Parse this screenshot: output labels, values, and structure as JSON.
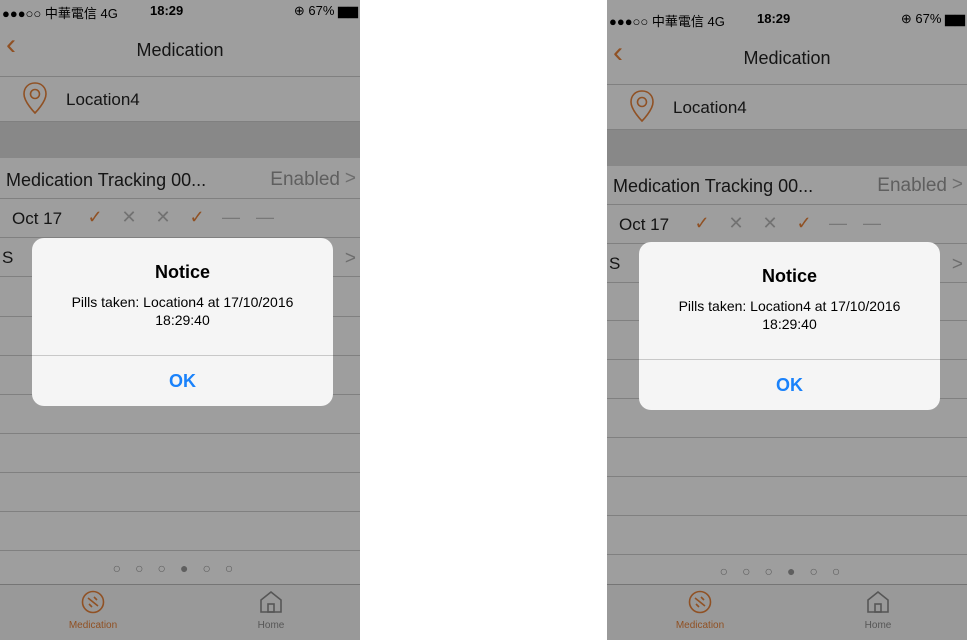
{
  "status": {
    "carrier": "●●●○○ 中華電信 4G",
    "time": "18:29",
    "battery": "⊕ 67% ▆▆"
  },
  "nav": {
    "back_icon": "‹",
    "title": "Medication"
  },
  "location": {
    "name": "Location4"
  },
  "tracking": {
    "label": "Medication Tracking 00...",
    "value": "Enabled",
    "chevron": ">"
  },
  "oct_row": {
    "date": "Oct 17",
    "marks": [
      "✓",
      "✕",
      "✕",
      "✓",
      "—",
      "—"
    ]
  },
  "second_row": {
    "letter": "S",
    "chevron": ">"
  },
  "page_dots": "○○○●○○",
  "tabs": [
    {
      "label": "Medication"
    },
    {
      "label": "Home"
    }
  ],
  "alert": {
    "title": "Notice",
    "message": "Pills taken: Location4 at 17/10/2016 18:29:40",
    "button": "OK"
  },
  "colors": {
    "accent": "#e8833a",
    "ios_blue": "#1a82fb"
  }
}
